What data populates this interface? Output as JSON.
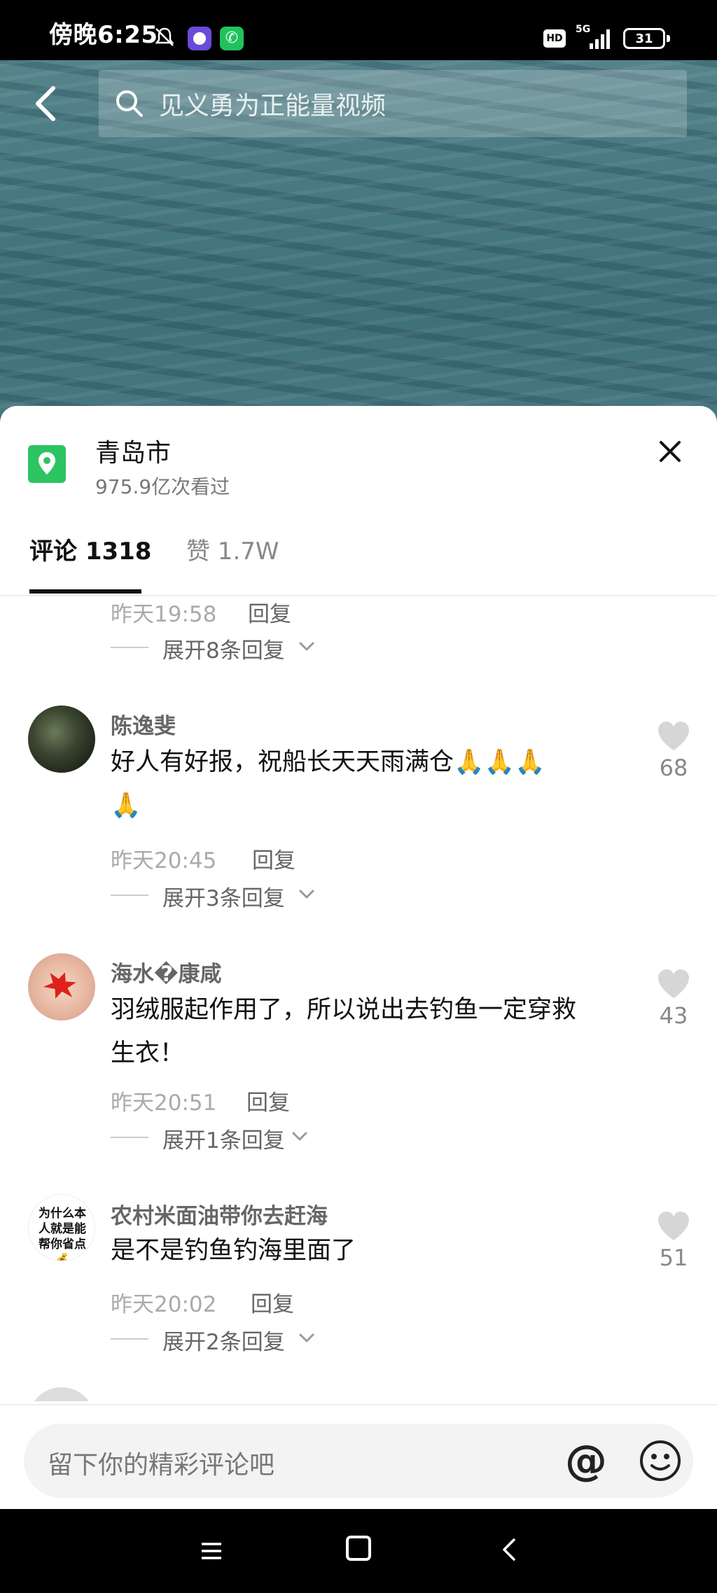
{
  "status_bar": {
    "time": "傍晚6:25",
    "hd_badge": "HD",
    "network": "5G",
    "battery_level": "31"
  },
  "search": {
    "query": "见义勇为正能量视频"
  },
  "location": {
    "title": "青岛市",
    "views": "975.9亿次看过"
  },
  "tabs": {
    "comments_label": "评论 1318",
    "likes_label": "赞 1.7W"
  },
  "comments_top": {
    "time": "昨天19:58",
    "reply": "回复",
    "expand": "展开8条回复"
  },
  "comments": [
    {
      "username": "陈逸斐",
      "text_line1": "好人有好报，祝船长天天雨满仓",
      "emojis_line1": "🙏🙏🙏",
      "emojis_line2": "🙏",
      "time": "昨天20:45",
      "reply": "回复",
      "expand": "展开3条回复",
      "likes": "68"
    },
    {
      "username": "海水�康咸",
      "text_line1": "羽绒服起作用了，所以说出去钓鱼一定穿救",
      "text_line2": "生衣！",
      "time": "昨天20:51",
      "reply": "回复",
      "expand": "展开1条回复",
      "likes": "43"
    },
    {
      "username": "农村米面油带你去赶海",
      "avatar_text": "为什么本人就是能帮你省点💰",
      "text_line1": "是不是钓鱼钓海里面了",
      "time": "昨天20:02",
      "reply": "回复",
      "expand": "展开2条回复",
      "likes": "51"
    }
  ],
  "input": {
    "placeholder": "留下你的精彩评论吧",
    "at_symbol": "@"
  },
  "colors": {
    "location_green": "#2dc462",
    "sheet_bg": "#ffffff",
    "muted_text": "#888888"
  },
  "icons": [
    "back-icon",
    "search-icon",
    "location-pin-icon",
    "close-icon",
    "heart-icon",
    "chevron-down-icon",
    "emoji-icon",
    "menu-icon",
    "home-icon",
    "nav-back-icon",
    "mute-icon"
  ]
}
